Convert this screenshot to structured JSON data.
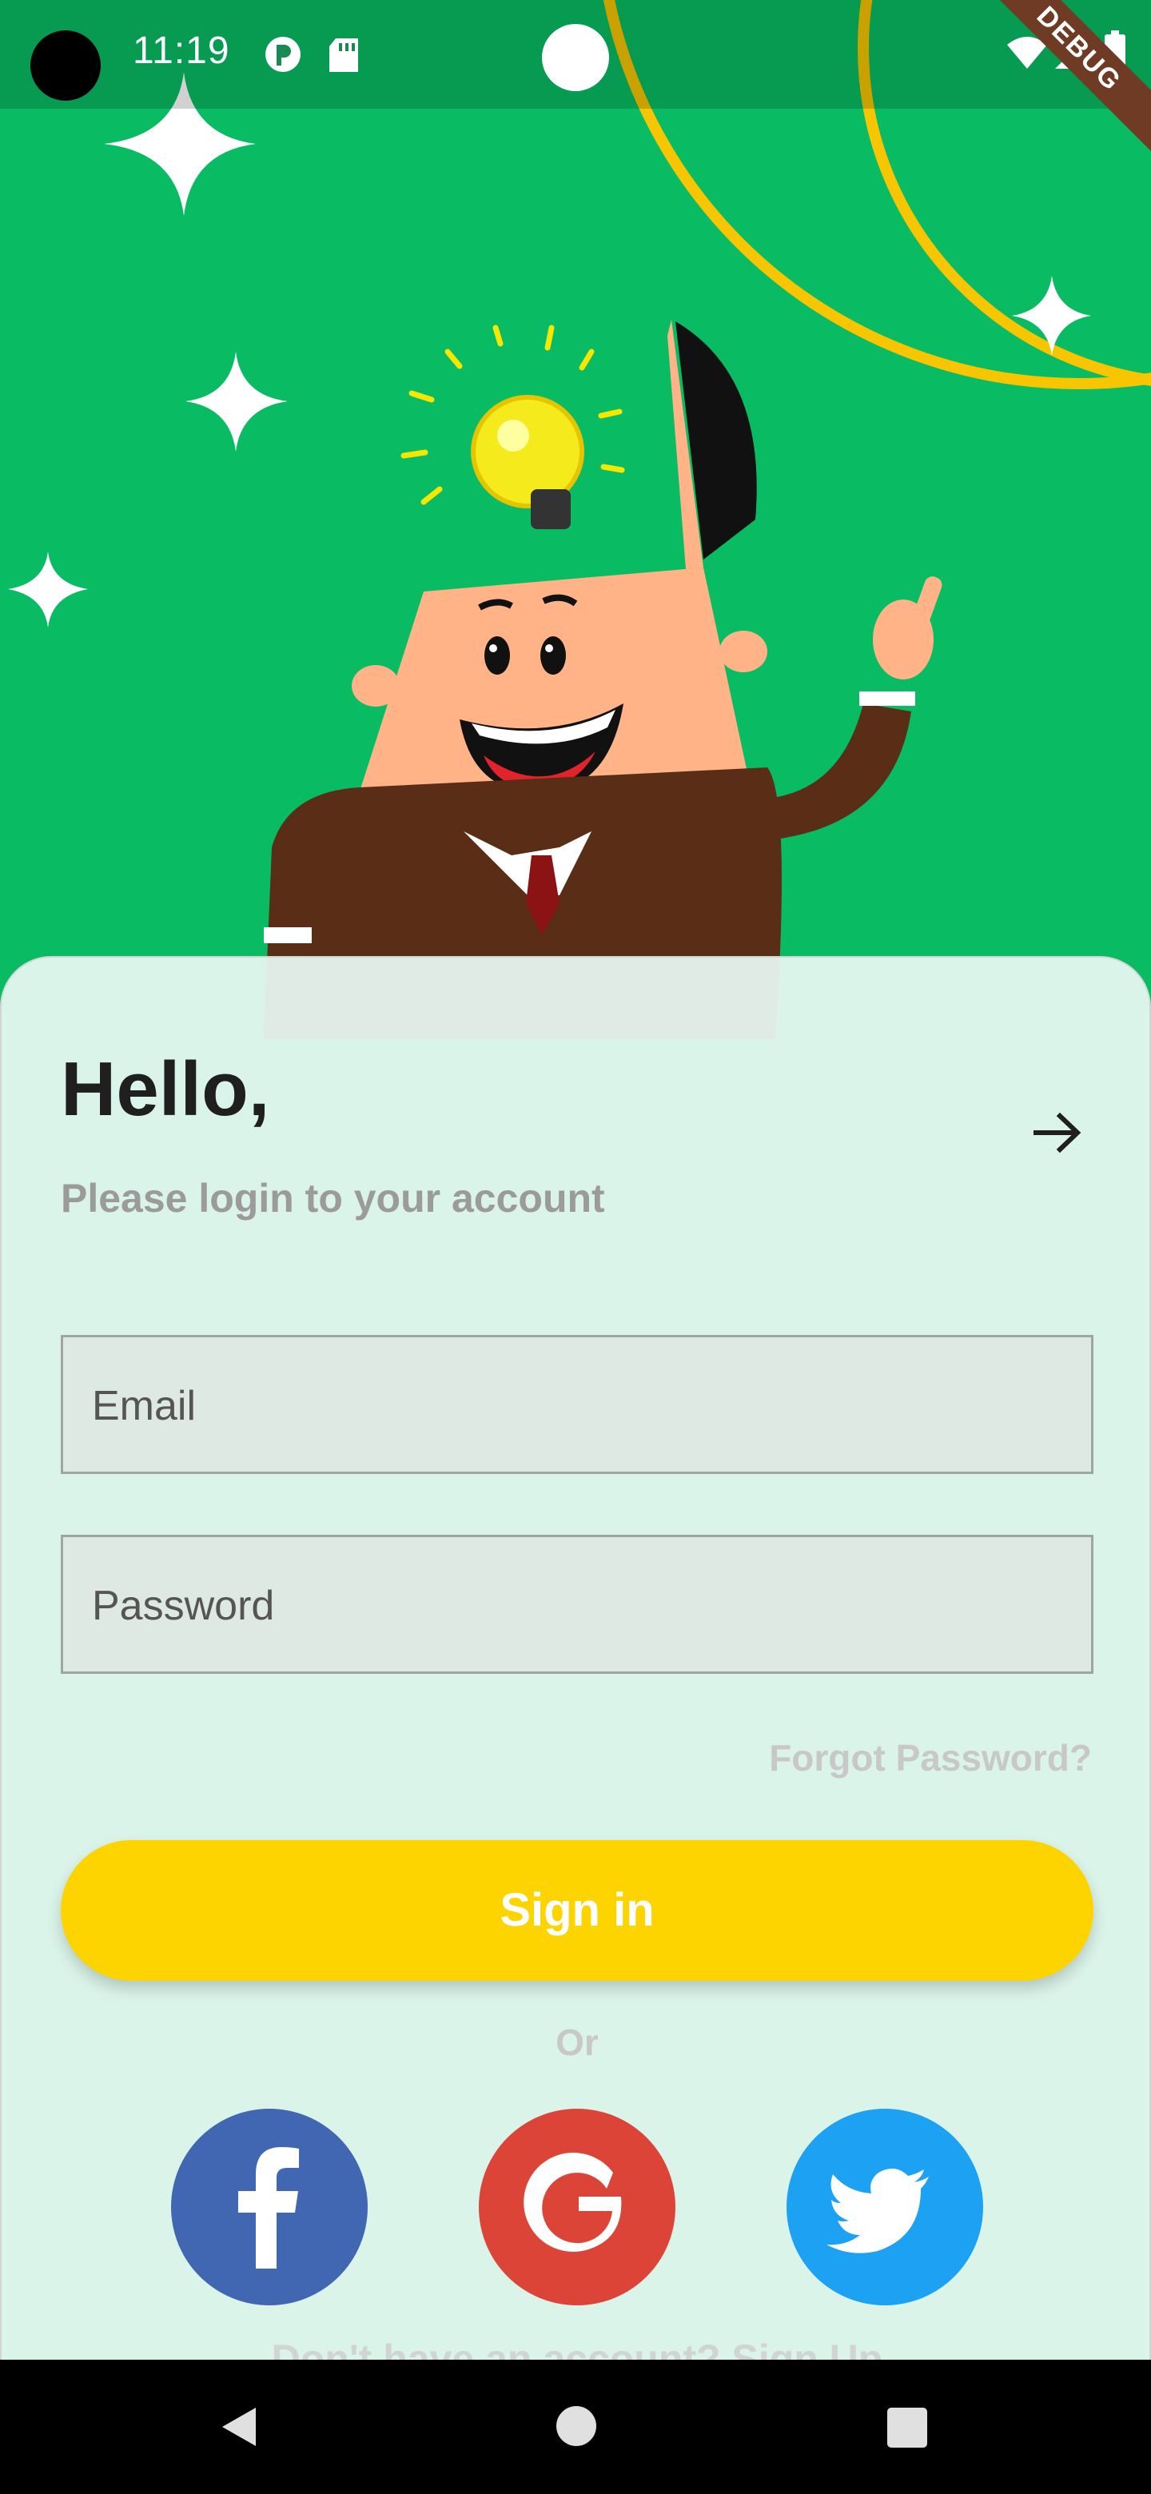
{
  "status_bar": {
    "time": "11:19",
    "debug_banner": "DEBUG"
  },
  "login": {
    "title": "Hello,",
    "subtitle": "Please login to your account",
    "email_placeholder": "Email",
    "password_placeholder": "Password",
    "forgot_password": "Forgot Password?",
    "sign_in": "Sign in",
    "or": "Or",
    "signup_prompt": "Don't have an account? Sign Up"
  },
  "social": [
    {
      "name": "facebook",
      "icon": "facebook-icon",
      "color": "#4267B2"
    },
    {
      "name": "google",
      "icon": "google-icon",
      "color": "#DB4437"
    },
    {
      "name": "twitter",
      "icon": "twitter-icon",
      "color": "#1DA1F2"
    }
  ],
  "colors": {
    "hero_bg": "#09BC63",
    "accent": "#FDD400",
    "sheet_bg": "#E8F8F1"
  }
}
